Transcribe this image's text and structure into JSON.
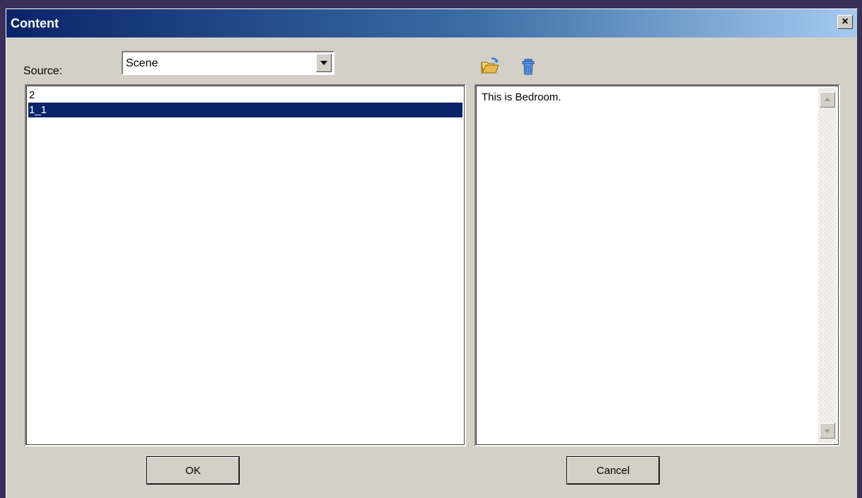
{
  "window": {
    "title": "Content",
    "close_label": "×"
  },
  "source": {
    "label": "Source:",
    "selected": "Scene"
  },
  "toolbar": {
    "open_icon": "open-folder-icon",
    "delete_icon": "trash-icon"
  },
  "list": {
    "items": [
      {
        "label": "2",
        "selected": false
      },
      {
        "label": "1_1",
        "selected": true
      }
    ]
  },
  "description": {
    "text": "This is Bedroom."
  },
  "buttons": {
    "ok_label": "OK",
    "cancel_label": "Cancel"
  },
  "colors": {
    "title_gradient_start": "#0a246a",
    "title_gradient_end": "#a6caf0",
    "dialog_bg": "#d4d0c8",
    "selection": "#0a246a",
    "desktop": "#3a2f5a"
  }
}
